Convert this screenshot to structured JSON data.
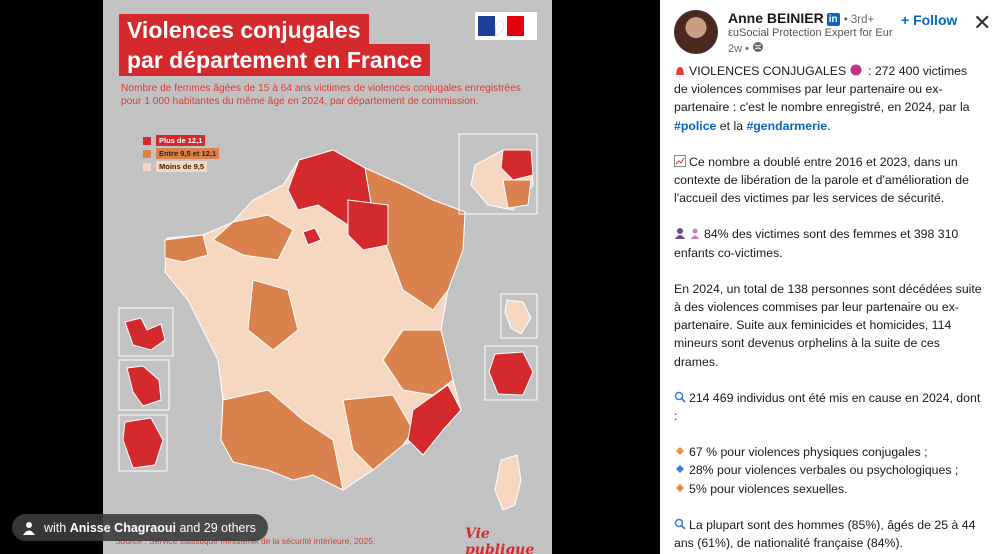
{
  "image": {
    "title_line1": "Violences conjugales",
    "title_line2": "par département en France",
    "subtitle": "Nombre de femmes âgées de 15 à 64 ans victimes de violences conjugales enregistrées pour 1 000 habitantes du même âge en 2024, par département de commission.",
    "legend": [
      {
        "label": "Plus de 12,1",
        "color": "#d42a2e"
      },
      {
        "label": "Entre 9,5 et 12,1",
        "color": "#d9824e"
      },
      {
        "label": "Moins de 9,5",
        "color": "#f6d8c2"
      }
    ],
    "source": "Source : Service statistique ministériel de la sécurité intérieure, 2025.",
    "brand": "Vie publique",
    "tagged_prefix": "with ",
    "tagged_name": "Anisse Chagraoui",
    "tagged_rest": " and 29 others"
  },
  "panel": {
    "author": "Anne BEINIER",
    "li_badge": "in",
    "degree": "• 3rd+",
    "headline": "εuSocial Protection Expert for Eur...",
    "time": "2w •",
    "follow_label": "+ Follow",
    "close_label": "✕",
    "paragraphs": {
      "p1_before": "VIOLENCES CONJUGALES",
      "p1_after": " : 272 400 victimes de violences commises par leur partenaire ou ex-partenaire : c'est le nombre enregistré, en 2024, par la ",
      "hashtag_police": "#police",
      "p1_mid": " et la ",
      "hashtag_gendarmerie": "#gendarmerie",
      "p1_end": ".",
      "p2": "Ce nombre a doublé entre 2016 et 2023, dans un contexte de libération de la parole et d'amélioration de l'accueil des victimes par les services de sécurité.",
      "p3": "84% des victimes sont des femmes et 398 310 enfants co-victimes.",
      "p4": "En 2024, un total de 138 personnes sont décédées suite à des violences commises par leur partenaire ou ex-partenaire. Suite aux feminicides et homicides, 114 mineurs sont devenus orphelins à la suite de ces drames.",
      "p5": "214 469 individus ont été mis en cause en 2024, dont :",
      "b1": "67 % pour violences physiques conjugales ;",
      "b2": "28% pour violences verbales ou psychologiques ;",
      "b3": "5% pour violences sexuelles.",
      "p6": "La plupart sont des hommes (85%), âgés de 25 à 44 ans (61%), de nationalité française (84%)."
    }
  }
}
